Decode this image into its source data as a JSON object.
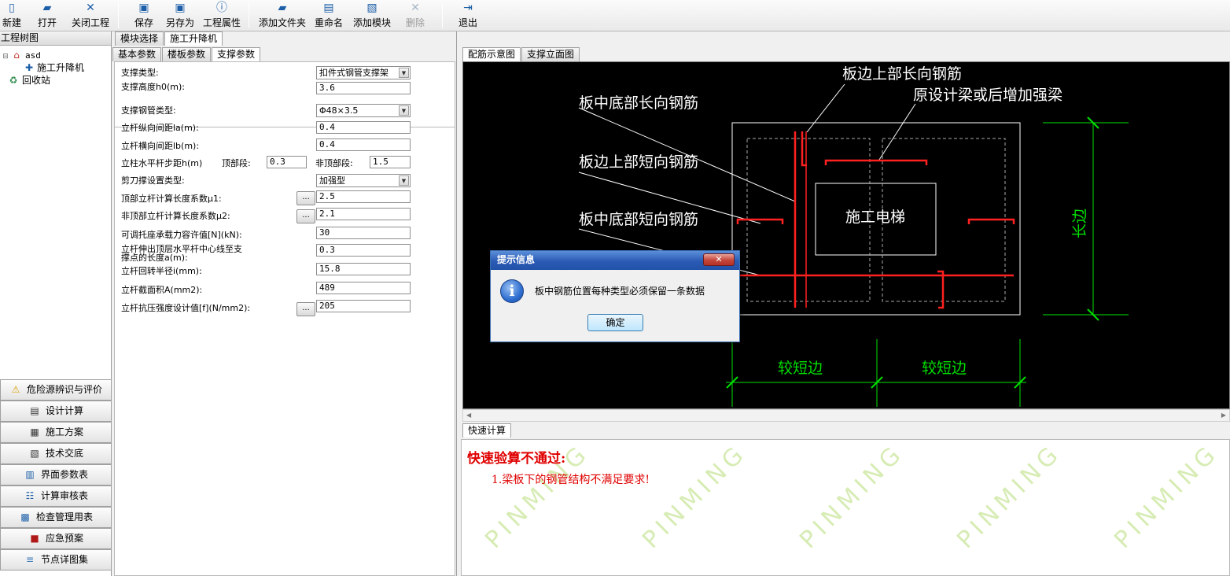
{
  "toolbar": {
    "new_label": "新建",
    "open_label": "打开",
    "close_project_label": "关闭工程",
    "save_label": "保存",
    "save_as_label": "另存为",
    "properties_label": "工程属性",
    "add_folder_label": "添加文件夹",
    "rename_label": "重命名",
    "add_module_label": "添加模块",
    "delete_label": "删除",
    "exit_label": "退出"
  },
  "left": {
    "tree_header": "工程树图",
    "tree": {
      "root": "asd",
      "child": "施工升降机",
      "recycle": "回收站"
    },
    "nav": [
      {
        "label": "危险源辨识与评价"
      },
      {
        "label": "设计计算"
      },
      {
        "label": "施工方案"
      },
      {
        "label": "技术交底"
      },
      {
        "label": "界面参数表"
      },
      {
        "label": "计算审核表"
      },
      {
        "label": "检查管理用表"
      },
      {
        "label": "应急预案"
      },
      {
        "label": "节点详图集"
      }
    ]
  },
  "mid": {
    "module_tabs": [
      "模块选择",
      "施工升降机"
    ],
    "param_tabs": [
      "基本参数",
      "楼板参数",
      "支撑参数"
    ],
    "fields": {
      "support_type_label": "支撑类型:",
      "support_type_value": "扣件式钢管支撑架",
      "support_height_label": "支撑高度h0(m):",
      "support_height_value": "3.6",
      "pipe_type_label": "支撑钢管类型:",
      "pipe_type_value": "Φ48×3.5",
      "la_label": "立杆纵向间距la(m):",
      "la_value": "0.4",
      "lb_label": "立杆横向间距lb(m):",
      "lb_value": "0.4",
      "step_label": "立柱水平杆步距h(m)",
      "top_seg_label": "顶部段:",
      "top_seg_value": "0.3",
      "non_top_seg_label": "非顶部段:",
      "non_top_seg_value": "1.5",
      "scissor_label": "剪刀撑设置类型:",
      "scissor_value": "加强型",
      "mu1_label": "顶部立杆计算长度系数μ1:",
      "mu1_value": "2.5",
      "mu2_label": "非顶部立杆计算长度系数μ2:",
      "mu2_value": "2.1",
      "bracket_label": "可调托座承载力容许值[N](kN):",
      "bracket_value": "30",
      "extend_label_1": "立杆伸出顶层水平杆中心线至支",
      "extend_label_2": "撑点的长度a(m):",
      "extend_value": "0.3",
      "radius_label": "立杆回转半径i(mm):",
      "radius_value": "15.8",
      "area_label": "立杆截面积A(mm2):",
      "area_value": "489",
      "strength_label": "立杆抗压强度设计值[f](N/mm2):",
      "strength_value": "205",
      "ellipsis": "..."
    }
  },
  "right": {
    "view_tabs": [
      "配筋示意图",
      "支撑立面图"
    ],
    "cad": {
      "label_edge_top_long": "板边上部长向钢筋",
      "label_original_beam": "原设计梁或后增加强梁",
      "label_mid_bottom_long": "板中底部长向钢筋",
      "label_edge_top_short": "板边上部短向钢筋",
      "label_mid_bottom_short": "板中底部短向钢筋",
      "label_elevator": "施工电梯",
      "label_long_edge": "长边",
      "label_short_edge_1": "较短边",
      "label_short_edge_2": "较短边"
    },
    "quick_tab": "快速计算",
    "result_title": "快速验算不通过:",
    "result_item": "1.梁板下的钢管结构不满足要求!",
    "watermark": "PINMING"
  },
  "dialog": {
    "title": "提示信息",
    "close": "✕",
    "message": "板中钢筋位置每种类型必须保留一条数据",
    "ok": "确定"
  },
  "colors": {
    "cad_bg": "#000000",
    "rebar": "#ff2020",
    "dim": "#00e000",
    "result_text": "#e00000",
    "dialog_title": "#2a5ab5"
  }
}
